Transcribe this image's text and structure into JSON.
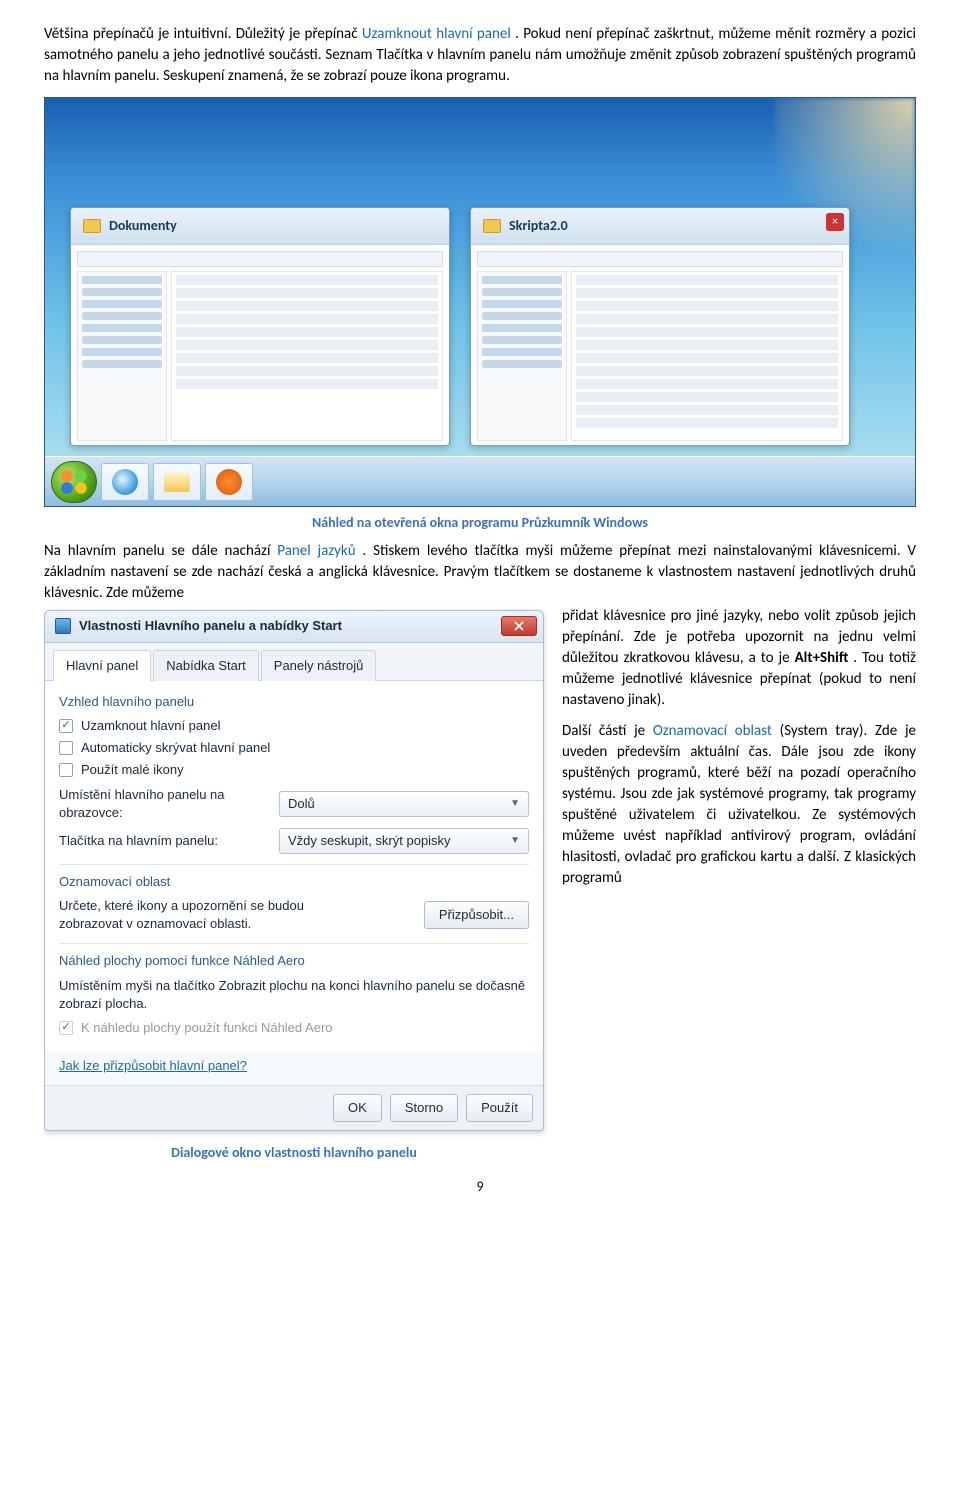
{
  "intro": {
    "p1_a": "Většina přepínačů je intuitivní. Důležitý je přepínač ",
    "p1_link": "Uzamknout hlavní panel",
    "p1_b": ". Pokud není přepínač zaškrtnut, můžeme měnit rozměry a pozici samotného panelu a jeho jednotlivé součásti. Seznam Tlačítka v hlavním panelu nám umožňuje změnit způsob zobrazení spuštěných programů na hlavním panelu. Seskupení znamená, že se zobrazí pouze ikona programu."
  },
  "preview": {
    "win1": "Dokumenty",
    "win2": "Skripta2.0"
  },
  "caption1": "Náhled na otevřená okna programu Průzkumník Windows",
  "mid": {
    "p_a": "Na hlavním panelu se dále nachází ",
    "p_link": "Panel jazyků",
    "p_b": ". Stiskem levého tlačítka myši můžeme přepínat mezi nainstalovanými klávesnicemi. V základním nastavení se zde nachází česká a anglická klávesnice. Pravým tlačítkem se dostaneme k vlastnostem nastavení jednotlivých druhů klávesnic. Zde můžeme"
  },
  "dialog": {
    "title": "Vlastnosti Hlavního panelu a nabídky Start",
    "tabs": {
      "t1": "Hlavní panel",
      "t2": "Nabídka Start",
      "t3": "Panely nástrojů"
    },
    "sec_appearance": "Vzhled hlavního panelu",
    "chk_lock": "Uzamknout hlavní panel",
    "chk_autohide": "Automaticky skrývat hlavní panel",
    "chk_small": "Použít malé ikony",
    "lbl_position": "Umístění hlavního panelu na obrazovce:",
    "sel_position": "Dolů",
    "lbl_buttons": "Tlačítka na hlavním panelu:",
    "sel_buttons": "Vždy seskupit, skrýt popisky",
    "sec_tray": "Oznamovací oblast",
    "tray_desc": "Určete, které ikony a upozornění se budou zobrazovat v oznamovací oblasti.",
    "btn_customize": "Přizpůsobit...",
    "sec_aero": "Náhled plochy pomocí funkce Náhled Aero",
    "aero_desc": "Umístěním myši na tlačítko Zobrazit plochu na konci hlavního panelu se dočasně zobrazí plocha.",
    "chk_aero": "K náhledu plochy použít funkci Náhled Aero",
    "help": "Jak lze přizpůsobit hlavní panel?",
    "btn_ok": "OK",
    "btn_cancel": "Storno",
    "btn_apply": "Použít"
  },
  "caption2": "Dialogové okno vlastnosti hlavního panelu",
  "right": {
    "p1_a": "přidat klávesnice pro jiné jazyky, nebo volit způsob jejich přepínání. Zde je potřeba upozornit na jednu velmi důležitou zkratkovou klávesu, a to je ",
    "p1_b": "Alt+Shift",
    "p1_c": ". Tou totiž můžeme jednotlivé klávesnice přepínat (pokud to není nastaveno jinak).",
    "p2_a": "Další částí je ",
    "p2_link": "Oznamovací oblast",
    "p2_b": " (System tray). Zde je uveden především aktuální čas. Dále jsou zde ikony spuštěných programů, které běží na pozadí operačního systému. Jsou zde jak systémové programy, tak programy spuštěné uživatelem či uživatelkou. Ze systémových můžeme uvést například antivirový program, ovládání hlasitosti, ovladač pro grafickou kartu a další. Z klasických programů"
  },
  "page_number": "9"
}
